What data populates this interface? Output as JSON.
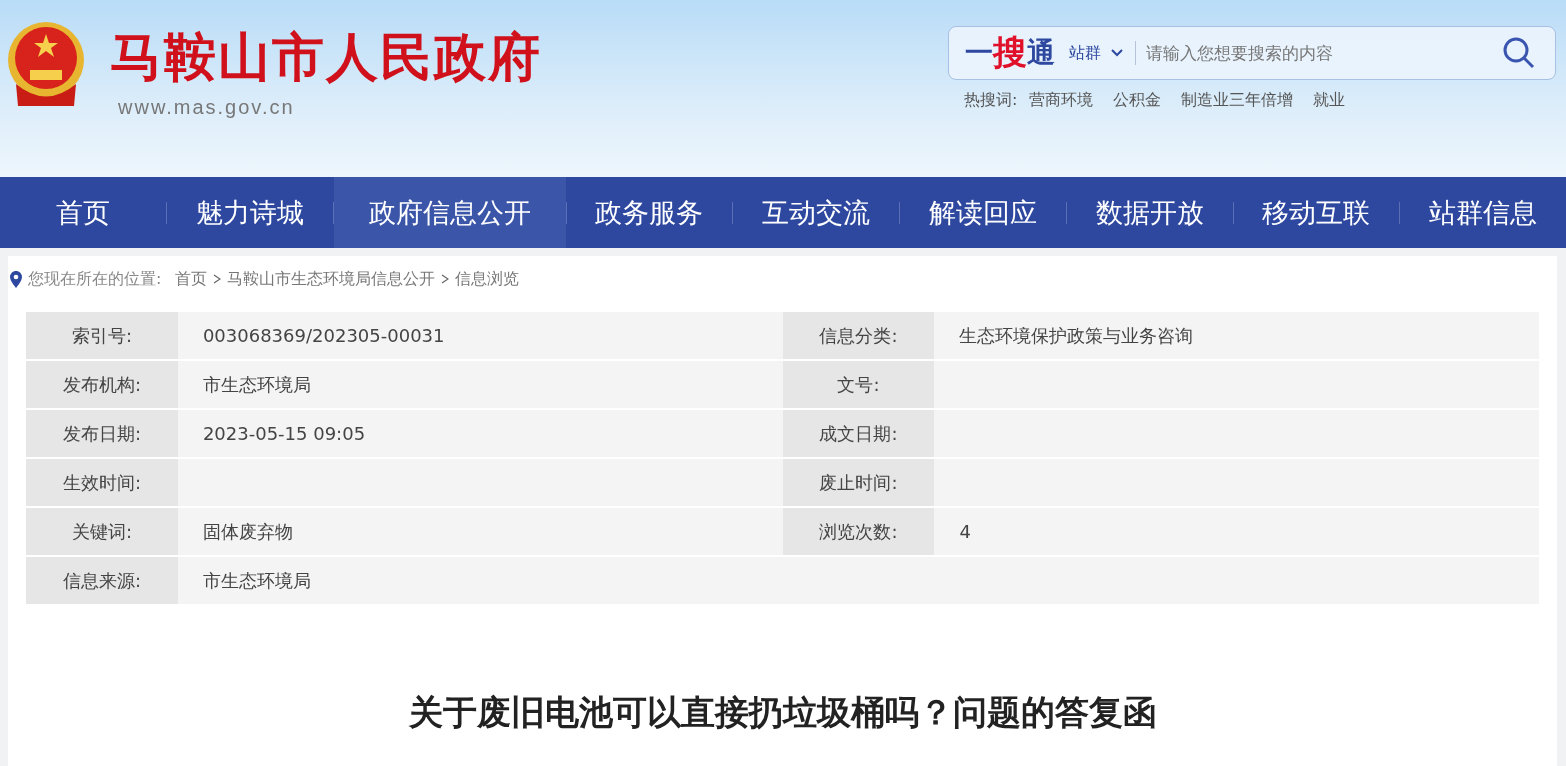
{
  "header": {
    "site_title": "马鞍山市人民政府",
    "site_url": "www.mas.gov.cn"
  },
  "search": {
    "logo": "一搜通",
    "scope": "站群",
    "placeholder": "请输入您想要搜索的内容",
    "hot_label": "热搜词:",
    "hot_words": [
      "营商环境",
      "公积金",
      "制造业三年倍增",
      "就业"
    ]
  },
  "nav": [
    {
      "label": "首页",
      "selected": false
    },
    {
      "label": "魅力诗城",
      "selected": false
    },
    {
      "label": "政府信息公开",
      "selected": true
    },
    {
      "label": "政务服务",
      "selected": false
    },
    {
      "label": "互动交流",
      "selected": false
    },
    {
      "label": "解读回应",
      "selected": false
    },
    {
      "label": "数据开放",
      "selected": false
    },
    {
      "label": "移动互联",
      "selected": false
    },
    {
      "label": "站群信息",
      "selected": false
    }
  ],
  "breadcrumb": {
    "label": "您现在所在的位置:",
    "items": [
      "首页",
      "马鞍山市生态环境局信息公开",
      "信息浏览"
    ]
  },
  "info_table": [
    [
      {
        "label": "索引号:",
        "value": "003068369/202305-00031"
      },
      {
        "label": "信息分类:",
        "value": "生态环境保护政策与业务咨询"
      }
    ],
    [
      {
        "label": "发布机构:",
        "value": "市生态环境局"
      },
      {
        "label": "文号:"
      }
    ],
    [
      {
        "label": "发布日期:",
        "value": "2023-05-15 09:05"
      },
      {
        "label": "成文日期:"
      }
    ],
    [
      {
        "label": "生效时间:"
      },
      {
        "label": "废止时间:"
      }
    ],
    [
      {
        "label": "关键词:",
        "value": "固体废弃物"
      },
      {
        "label": "浏览次数:",
        "value": "4"
      }
    ],
    [
      {
        "label": "信息来源:",
        "value": "市生态环境局"
      }
    ]
  ],
  "article_title": "关于废旧电池可以直接扔垃圾桶吗？问题的答复函"
}
